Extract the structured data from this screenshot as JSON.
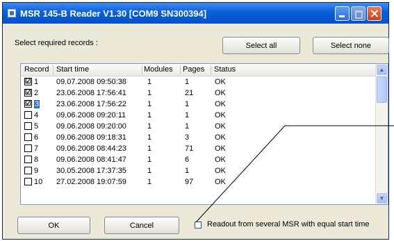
{
  "window": {
    "title": "MSR 145-B Reader  V1.30  [COM9  SN300394]"
  },
  "prompt": "Select required records :",
  "buttons": {
    "select_all": "Select all",
    "select_none": "Select none",
    "ok": "OK",
    "cancel": "Cancel"
  },
  "table": {
    "columns": [
      "Record",
      "Start time",
      "Modules",
      "Pages",
      "Status"
    ],
    "rows": [
      {
        "record": "1",
        "checked": "☑",
        "start": "09.07.2008 09:50:38",
        "modules": "1",
        "pages": "1",
        "status": "OK"
      },
      {
        "record": "2",
        "checked": "☑",
        "start": "23.06.2008 17:56:41",
        "modules": "1",
        "pages": "21",
        "status": "OK"
      },
      {
        "record": "3",
        "checked": "☑",
        "start": "23.06.2008 17:56:22",
        "modules": "1",
        "pages": "1",
        "status": "OK"
      },
      {
        "record": "4",
        "checked": "",
        "start": "09.06.2008 09:20:11",
        "modules": "1",
        "pages": "1",
        "status": "OK"
      },
      {
        "record": "5",
        "checked": "",
        "start": "09.06.2008 09:20:00",
        "modules": "1",
        "pages": "1",
        "status": "OK"
      },
      {
        "record": "6",
        "checked": "",
        "start": "09.06.2008 09:18:31",
        "modules": "1",
        "pages": "3",
        "status": "OK"
      },
      {
        "record": "7",
        "checked": "",
        "start": "09.06.2008 08:44:23",
        "modules": "1",
        "pages": "71",
        "status": "OK"
      },
      {
        "record": "8",
        "checked": "",
        "start": "09.06.2008 08:41:47",
        "modules": "1",
        "pages": "6",
        "status": "OK"
      },
      {
        "record": "9",
        "checked": "",
        "start": "30.05.2008 17:37:35",
        "modules": "1",
        "pages": "1",
        "status": "OK"
      },
      {
        "record": "10",
        "checked": "",
        "start": "27.02.2008 19:07:59",
        "modules": "1",
        "pages": "97",
        "status": "OK"
      }
    ]
  },
  "readout_option": {
    "label": "Readout from several MSR with equal start time"
  },
  "colors": {
    "titlebar": "#0a5fd8",
    "selection": "#316ac5",
    "dialog_bg": "#ece9d8"
  },
  "icons": [
    "app-icon",
    "minimize-icon",
    "maximize-icon",
    "close-icon",
    "scroll-up-icon",
    "scroll-down-icon"
  ]
}
